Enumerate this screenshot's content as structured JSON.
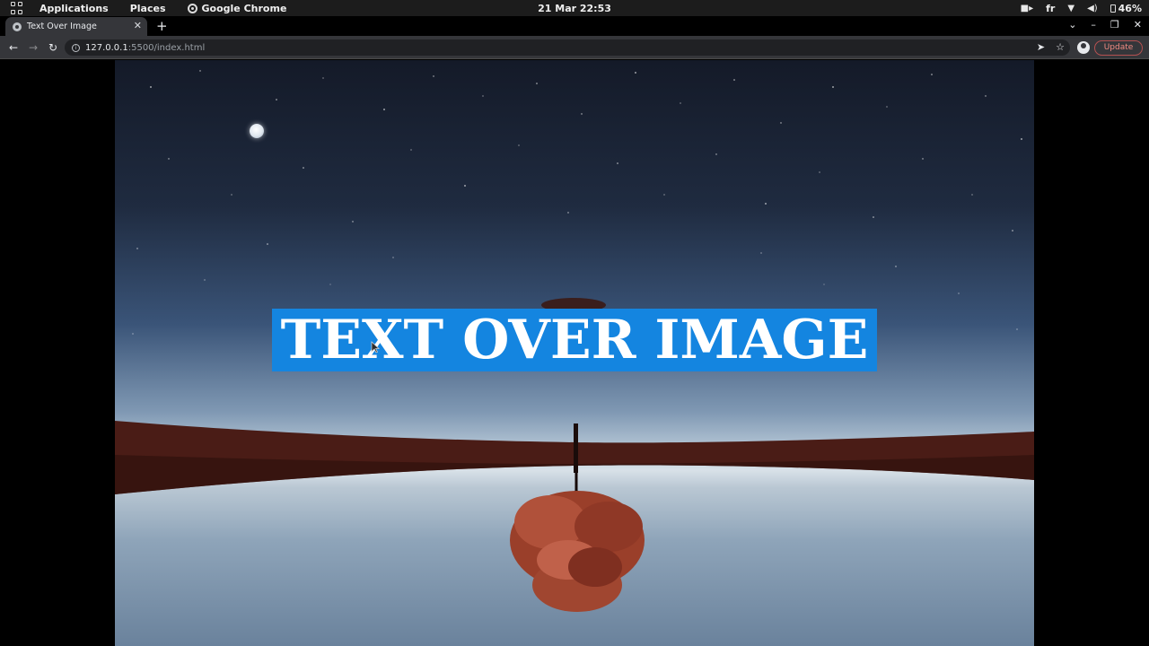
{
  "topbar": {
    "applications": "Applications",
    "places": "Places",
    "app_name": "Google Chrome",
    "datetime": "21 Mar  22:53",
    "keyboard_layout": "fr",
    "battery": "46%"
  },
  "browser": {
    "tab_title": "Text Over Image",
    "url_host": "127.0.0.1",
    "url_rest": ":5500/index.html",
    "update_label": "Update"
  },
  "page": {
    "headline": "TEXT OVER IMAGE",
    "headline_bg_color": "#1485e0"
  }
}
